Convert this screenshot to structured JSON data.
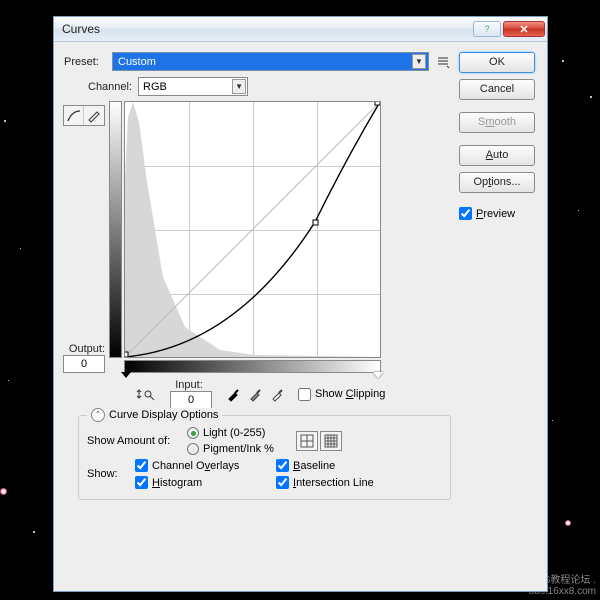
{
  "window": {
    "title": "Curves"
  },
  "preset": {
    "label": "Preset:",
    "value": "Custom"
  },
  "channel": {
    "label": "Channel:",
    "value": "RGB"
  },
  "output": {
    "label": "Output:",
    "value": "0"
  },
  "input": {
    "label": "Input:",
    "value": "0"
  },
  "show_clipping": {
    "label_pre": "Show ",
    "label_u": "C",
    "label_post": "lipping"
  },
  "cd_options": {
    "title": "Curve Display Options"
  },
  "show_amount": {
    "label": "Show Amount of:",
    "light": "Light  (0-255)",
    "pigment": "Pigment/Ink %"
  },
  "show": {
    "label": "Show:",
    "channel_overlays": {
      "pre": "Channel O",
      "u": "v",
      "post": "erlays"
    },
    "histogram": {
      "pre": "",
      "u": "H",
      "post": "istogram"
    },
    "baseline": {
      "pre": "",
      "u": "B",
      "post": "aseline"
    },
    "intersection": {
      "pre": "",
      "u": "I",
      "post": "ntersection Line"
    }
  },
  "buttons": {
    "ok": "OK",
    "cancel": "Cancel",
    "smooth_pre": "S",
    "smooth_u": "m",
    "smooth_post": "ooth",
    "auto_u": "A",
    "auto_post": "uto",
    "options": {
      "pre": "Op",
      "u": "t",
      "post": "ions..."
    },
    "preview": {
      "u": "P",
      "post": "review"
    }
  },
  "chart_data": {
    "type": "line",
    "title": "Curves",
    "xlabel": "Input",
    "ylabel": "Output",
    "xlim": [
      0,
      255
    ],
    "ylim": [
      0,
      255
    ],
    "series": [
      {
        "name": "baseline",
        "x": [
          0,
          255
        ],
        "y": [
          0,
          255
        ]
      },
      {
        "name": "curve",
        "x": [
          0,
          64,
          128,
          190,
          255
        ],
        "y": [
          0,
          16,
          58,
          135,
          255
        ]
      }
    ],
    "control_points": [
      {
        "x": 190,
        "y": 135
      }
    ],
    "histogram": {
      "peak_x": 8,
      "peak_y": 255,
      "tail_x": 120
    }
  },
  "watermark": {
    "l1": "PS教程论坛 .",
    "l2": "bbs.16xx8.com"
  }
}
